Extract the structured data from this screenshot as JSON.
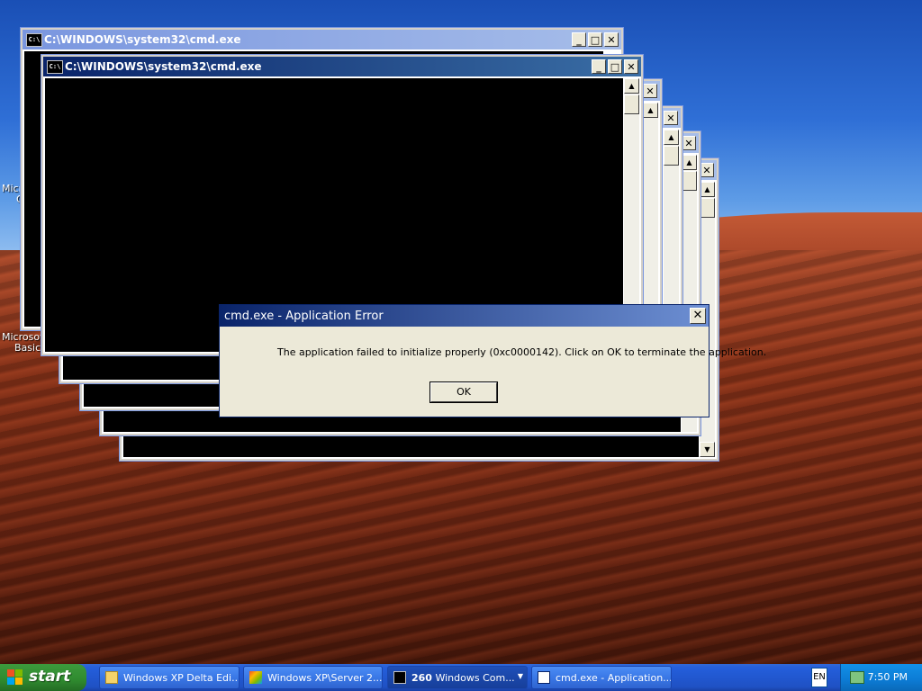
{
  "desktop": {
    "icon_labels": [
      "Microsof",
      "C",
      "Microsoft",
      "Basic"
    ]
  },
  "console_windows": [
    {
      "title": "C:\\WINDOWS\\system32\\cmd.exe",
      "state": "inactive"
    },
    {
      "title": "C:\\WINDOWS\\system32\\cmd.exe",
      "state": "active"
    }
  ],
  "window_buttons": {
    "minimize": "_",
    "maximize": "□",
    "close": "✕"
  },
  "scroll": {
    "up": "▲",
    "down": "▼"
  },
  "dialog": {
    "title": "cmd.exe - Application Error",
    "message": "The application failed to initialize properly (0xc0000142). Click on OK to terminate the application.",
    "ok_label": "OK",
    "close": "✕"
  },
  "taskbar": {
    "start_label": "start",
    "items": [
      {
        "label": "Windows XP Delta Edi...",
        "icon": "folder-icon"
      },
      {
        "label": "Windows XP\\Server 2...",
        "icon": "app-icon"
      },
      {
        "label": "260 Windows Com...",
        "icon": "console-icon",
        "count": "260",
        "text": "Windows Com..."
      },
      {
        "label": "cmd.exe - Application...",
        "icon": "window-icon"
      }
    ],
    "language": "EN",
    "time": "7:50 PM"
  },
  "colors": {
    "title_active": "#0a246a",
    "taskbar": "#245edb",
    "start": "#2f8a2f"
  }
}
